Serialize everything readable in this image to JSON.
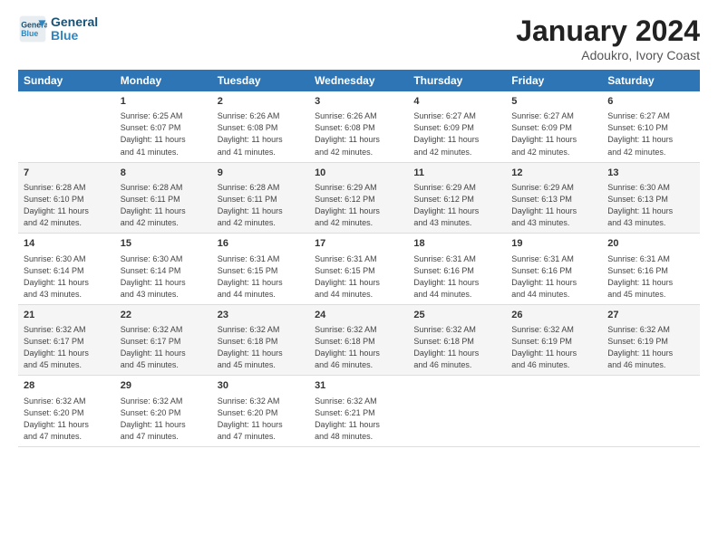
{
  "header": {
    "logo_line1": "General",
    "logo_line2": "Blue",
    "month_title": "January 2024",
    "location": "Adoukro, Ivory Coast"
  },
  "weekdays": [
    "Sunday",
    "Monday",
    "Tuesday",
    "Wednesday",
    "Thursday",
    "Friday",
    "Saturday"
  ],
  "weeks": [
    [
      {
        "day": "",
        "info": ""
      },
      {
        "day": "1",
        "info": "Sunrise: 6:25 AM\nSunset: 6:07 PM\nDaylight: 11 hours\nand 41 minutes."
      },
      {
        "day": "2",
        "info": "Sunrise: 6:26 AM\nSunset: 6:08 PM\nDaylight: 11 hours\nand 41 minutes."
      },
      {
        "day": "3",
        "info": "Sunrise: 6:26 AM\nSunset: 6:08 PM\nDaylight: 11 hours\nand 42 minutes."
      },
      {
        "day": "4",
        "info": "Sunrise: 6:27 AM\nSunset: 6:09 PM\nDaylight: 11 hours\nand 42 minutes."
      },
      {
        "day": "5",
        "info": "Sunrise: 6:27 AM\nSunset: 6:09 PM\nDaylight: 11 hours\nand 42 minutes."
      },
      {
        "day": "6",
        "info": "Sunrise: 6:27 AM\nSunset: 6:10 PM\nDaylight: 11 hours\nand 42 minutes."
      }
    ],
    [
      {
        "day": "7",
        "info": "Sunrise: 6:28 AM\nSunset: 6:10 PM\nDaylight: 11 hours\nand 42 minutes."
      },
      {
        "day": "8",
        "info": "Sunrise: 6:28 AM\nSunset: 6:11 PM\nDaylight: 11 hours\nand 42 minutes."
      },
      {
        "day": "9",
        "info": "Sunrise: 6:28 AM\nSunset: 6:11 PM\nDaylight: 11 hours\nand 42 minutes."
      },
      {
        "day": "10",
        "info": "Sunrise: 6:29 AM\nSunset: 6:12 PM\nDaylight: 11 hours\nand 42 minutes."
      },
      {
        "day": "11",
        "info": "Sunrise: 6:29 AM\nSunset: 6:12 PM\nDaylight: 11 hours\nand 43 minutes."
      },
      {
        "day": "12",
        "info": "Sunrise: 6:29 AM\nSunset: 6:13 PM\nDaylight: 11 hours\nand 43 minutes."
      },
      {
        "day": "13",
        "info": "Sunrise: 6:30 AM\nSunset: 6:13 PM\nDaylight: 11 hours\nand 43 minutes."
      }
    ],
    [
      {
        "day": "14",
        "info": "Sunrise: 6:30 AM\nSunset: 6:14 PM\nDaylight: 11 hours\nand 43 minutes."
      },
      {
        "day": "15",
        "info": "Sunrise: 6:30 AM\nSunset: 6:14 PM\nDaylight: 11 hours\nand 43 minutes."
      },
      {
        "day": "16",
        "info": "Sunrise: 6:31 AM\nSunset: 6:15 PM\nDaylight: 11 hours\nand 44 minutes."
      },
      {
        "day": "17",
        "info": "Sunrise: 6:31 AM\nSunset: 6:15 PM\nDaylight: 11 hours\nand 44 minutes."
      },
      {
        "day": "18",
        "info": "Sunrise: 6:31 AM\nSunset: 6:16 PM\nDaylight: 11 hours\nand 44 minutes."
      },
      {
        "day": "19",
        "info": "Sunrise: 6:31 AM\nSunset: 6:16 PM\nDaylight: 11 hours\nand 44 minutes."
      },
      {
        "day": "20",
        "info": "Sunrise: 6:31 AM\nSunset: 6:16 PM\nDaylight: 11 hours\nand 45 minutes."
      }
    ],
    [
      {
        "day": "21",
        "info": "Sunrise: 6:32 AM\nSunset: 6:17 PM\nDaylight: 11 hours\nand 45 minutes."
      },
      {
        "day": "22",
        "info": "Sunrise: 6:32 AM\nSunset: 6:17 PM\nDaylight: 11 hours\nand 45 minutes."
      },
      {
        "day": "23",
        "info": "Sunrise: 6:32 AM\nSunset: 6:18 PM\nDaylight: 11 hours\nand 45 minutes."
      },
      {
        "day": "24",
        "info": "Sunrise: 6:32 AM\nSunset: 6:18 PM\nDaylight: 11 hours\nand 46 minutes."
      },
      {
        "day": "25",
        "info": "Sunrise: 6:32 AM\nSunset: 6:18 PM\nDaylight: 11 hours\nand 46 minutes."
      },
      {
        "day": "26",
        "info": "Sunrise: 6:32 AM\nSunset: 6:19 PM\nDaylight: 11 hours\nand 46 minutes."
      },
      {
        "day": "27",
        "info": "Sunrise: 6:32 AM\nSunset: 6:19 PM\nDaylight: 11 hours\nand 46 minutes."
      }
    ],
    [
      {
        "day": "28",
        "info": "Sunrise: 6:32 AM\nSunset: 6:20 PM\nDaylight: 11 hours\nand 47 minutes."
      },
      {
        "day": "29",
        "info": "Sunrise: 6:32 AM\nSunset: 6:20 PM\nDaylight: 11 hours\nand 47 minutes."
      },
      {
        "day": "30",
        "info": "Sunrise: 6:32 AM\nSunset: 6:20 PM\nDaylight: 11 hours\nand 47 minutes."
      },
      {
        "day": "31",
        "info": "Sunrise: 6:32 AM\nSunset: 6:21 PM\nDaylight: 11 hours\nand 48 minutes."
      },
      {
        "day": "",
        "info": ""
      },
      {
        "day": "",
        "info": ""
      },
      {
        "day": "",
        "info": ""
      }
    ]
  ]
}
